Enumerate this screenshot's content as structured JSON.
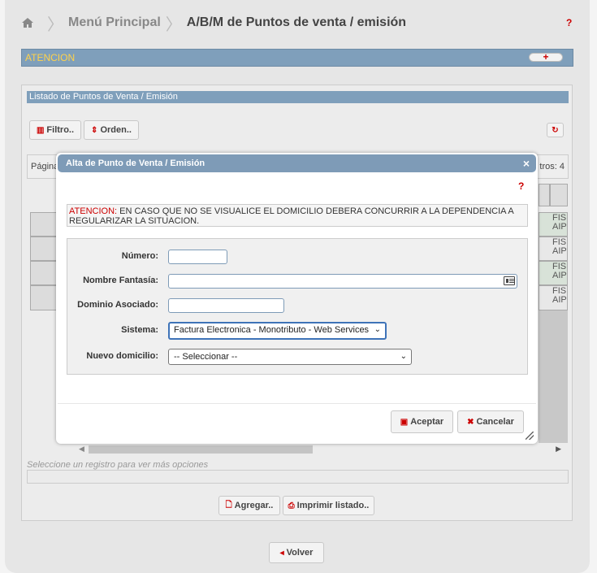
{
  "breadcrumb": {
    "home_icon": "home-icon",
    "parent": "Menú Principal",
    "current": "A/B/M de Puntos de venta / emisión",
    "help": "?"
  },
  "attention_bar": {
    "label": "ATENCION",
    "toggle": "+"
  },
  "list": {
    "title": "Listado de Puntos de Venta / Emisión",
    "filter_button": "Filtro..",
    "order_button": "Orden..",
    "pager_left": "Página",
    "pager_right": "tros: 4",
    "rows": [
      {
        "line1": "FIS",
        "line2": "AIP"
      },
      {
        "line1": "FIS",
        "line2": "AIP"
      },
      {
        "line1": "FIS",
        "line2": "AIP"
      },
      {
        "line1": "FIS",
        "line2": "AIP"
      }
    ],
    "select_hint": "Seleccione un registro para ver más opciones",
    "add_button": "Agregar..",
    "print_button": "Imprimir listado.."
  },
  "back_button": "Volver",
  "dialog": {
    "title": "Alta de Punto de Venta / Emisión",
    "close": "×",
    "help": "?",
    "attention_label": "ATENCION:",
    "attention_text": " EN CASO QUE NO SE VISUALICE EL DOMICILIO DEBERA CONCURRIR A LA DEPENDENCIA A REGULARIZAR LA SITUACION.",
    "fields": {
      "numero_label": "Número:",
      "numero_value": "",
      "fantasia_label": "Nombre Fantasía:",
      "fantasia_value": "",
      "dominio_label": "Dominio Asociado:",
      "dominio_value": "",
      "sistema_label": "Sistema:",
      "sistema_value": "Factura Electronica - Monotributo - Web Services",
      "domicilio_label": "Nuevo domicilio:",
      "domicilio_value": "-- Seleccionar --"
    },
    "accept_button": "Aceptar",
    "cancel_button": "Cancelar"
  },
  "colors": {
    "accent": "#7f9fbb",
    "attention": "#ffd24a",
    "danger": "#cc0000"
  }
}
